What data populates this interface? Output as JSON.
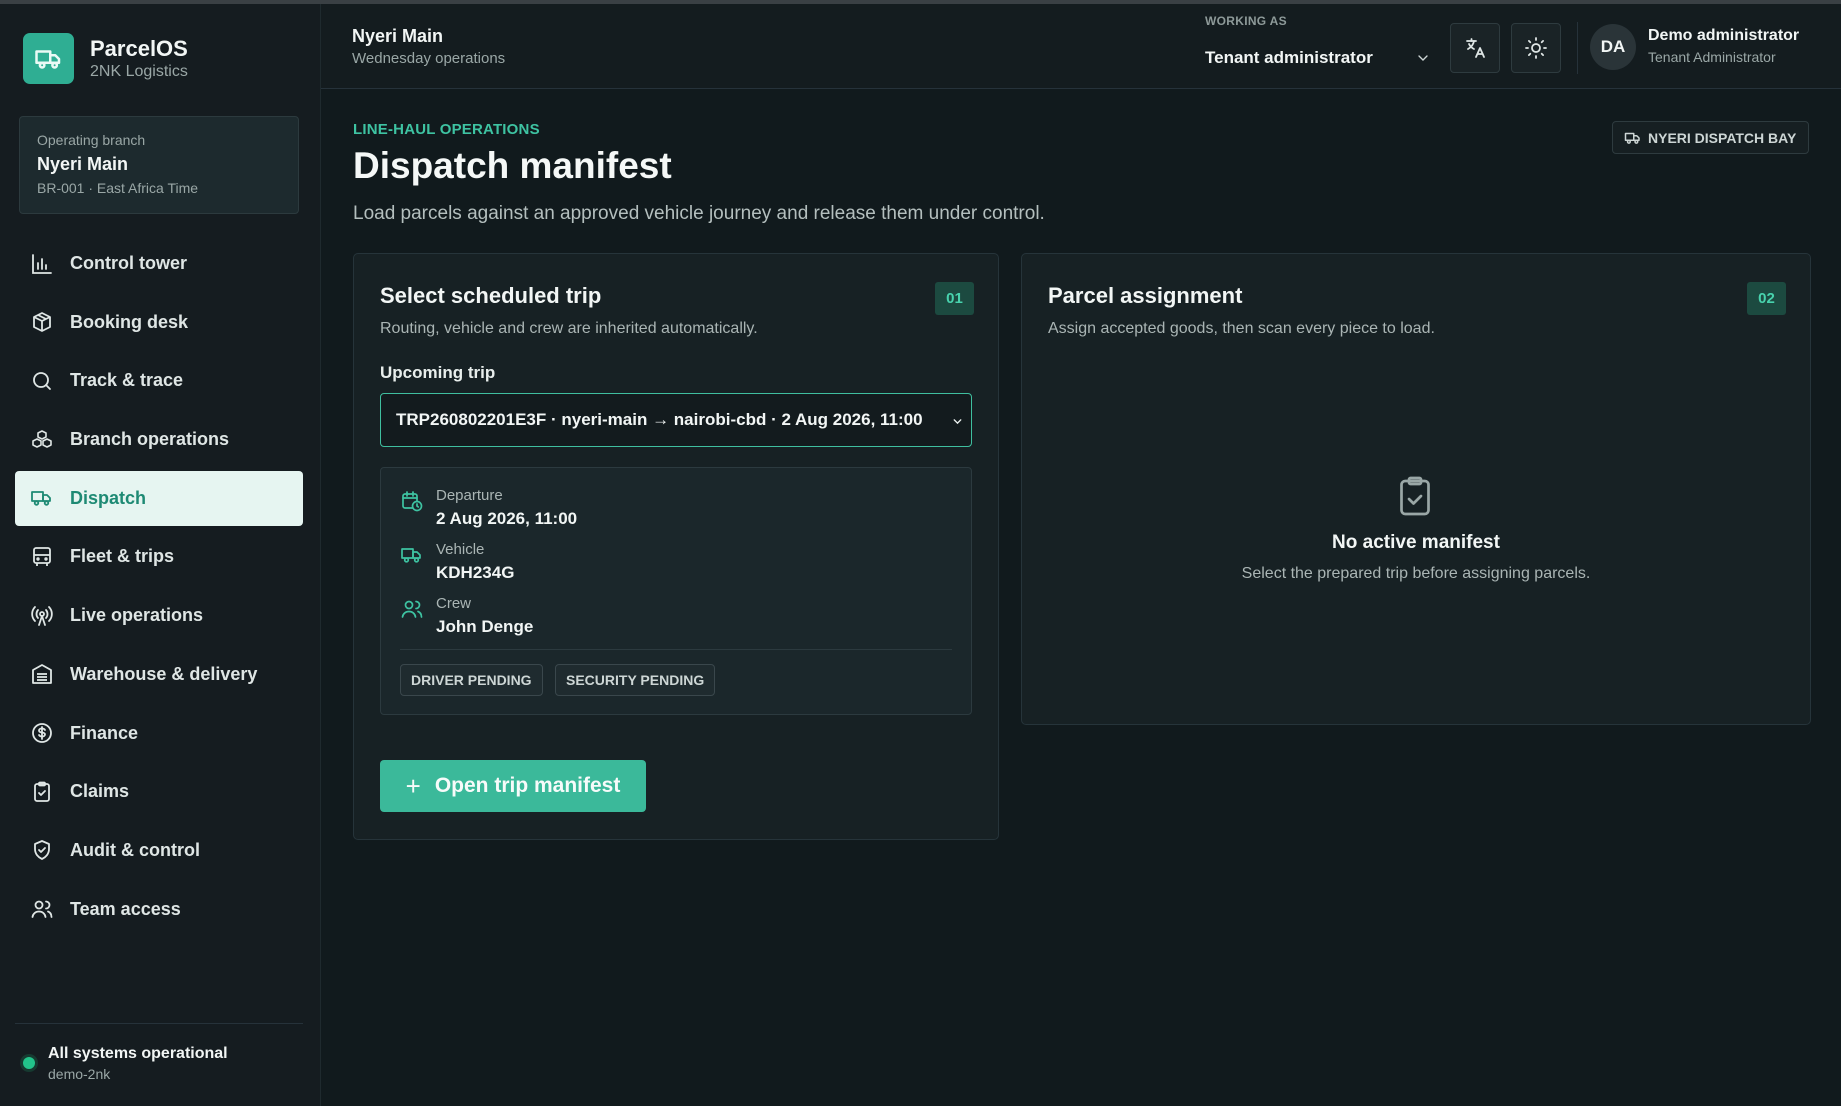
{
  "app": {
    "name": "ParcelOS",
    "org": "2NK Logistics"
  },
  "branch": {
    "caption": "Operating branch",
    "name": "Nyeri Main",
    "meta": "BR-001 · East Africa Time"
  },
  "nav": [
    {
      "label": "Control tower",
      "icon": "bar-chart-icon",
      "active": false
    },
    {
      "label": "Booking desk",
      "icon": "package-icon",
      "active": false
    },
    {
      "label": "Track & trace",
      "icon": "search-icon",
      "active": false
    },
    {
      "label": "Branch operations",
      "icon": "boxes-icon",
      "active": false
    },
    {
      "label": "Dispatch",
      "icon": "truck-icon",
      "active": true
    },
    {
      "label": "Fleet & trips",
      "icon": "bus-icon",
      "active": false
    },
    {
      "label": "Live operations",
      "icon": "radio-tower-icon",
      "active": false
    },
    {
      "label": "Warehouse & delivery",
      "icon": "warehouse-icon",
      "active": false
    },
    {
      "label": "Finance",
      "icon": "dollar-circle-icon",
      "active": false
    },
    {
      "label": "Claims",
      "icon": "clipboard-check-icon",
      "active": false
    },
    {
      "label": "Audit & control",
      "icon": "shield-check-icon",
      "active": false
    },
    {
      "label": "Team access",
      "icon": "users-icon",
      "active": false
    }
  ],
  "system": {
    "status": "All systems operational",
    "tenant": "demo-2nk",
    "status_color": "#22c38a"
  },
  "topbar": {
    "title": "Nyeri Main",
    "subtitle": "Wednesday operations",
    "working_as_caption": "WORKING AS",
    "working_as_value": "Tenant administrator",
    "avatar_initials": "DA",
    "user_name": "Demo administrator",
    "user_role": "Tenant Administrator"
  },
  "page": {
    "eyebrow": "LINE-HAUL OPERATIONS",
    "title": "Dispatch manifest",
    "description": "Load parcels against an approved vehicle journey and release them under control.",
    "bay_badge": "NYERI DISPATCH BAY"
  },
  "trip_card": {
    "title": "Select scheduled trip",
    "subtitle": "Routing, vehicle and crew are inherited automatically.",
    "step": "01",
    "field_label": "Upcoming trip",
    "selected_trip": "TRP260802201E3F · nyeri-main → nairobi-cbd · 2 Aug 2026, 11:00",
    "departure_caption": "Departure",
    "departure_value": "2 Aug 2026, 11:00",
    "vehicle_caption": "Vehicle",
    "vehicle_value": "KDH234G",
    "crew_caption": "Crew",
    "crew_value": "John Denge",
    "pills": [
      "DRIVER PENDING",
      "SECURITY PENDING"
    ],
    "open_button": "Open trip manifest"
  },
  "parcel_card": {
    "title": "Parcel assignment",
    "subtitle": "Assign accepted goods, then scan every piece to load.",
    "step": "02",
    "empty_title": "No active manifest",
    "empty_subtitle": "Select the prepared trip before assigning parcels."
  },
  "colors": {
    "accent": "#3bb99a",
    "eyebrow": "#3ec3a2",
    "background": "#111a1d"
  }
}
